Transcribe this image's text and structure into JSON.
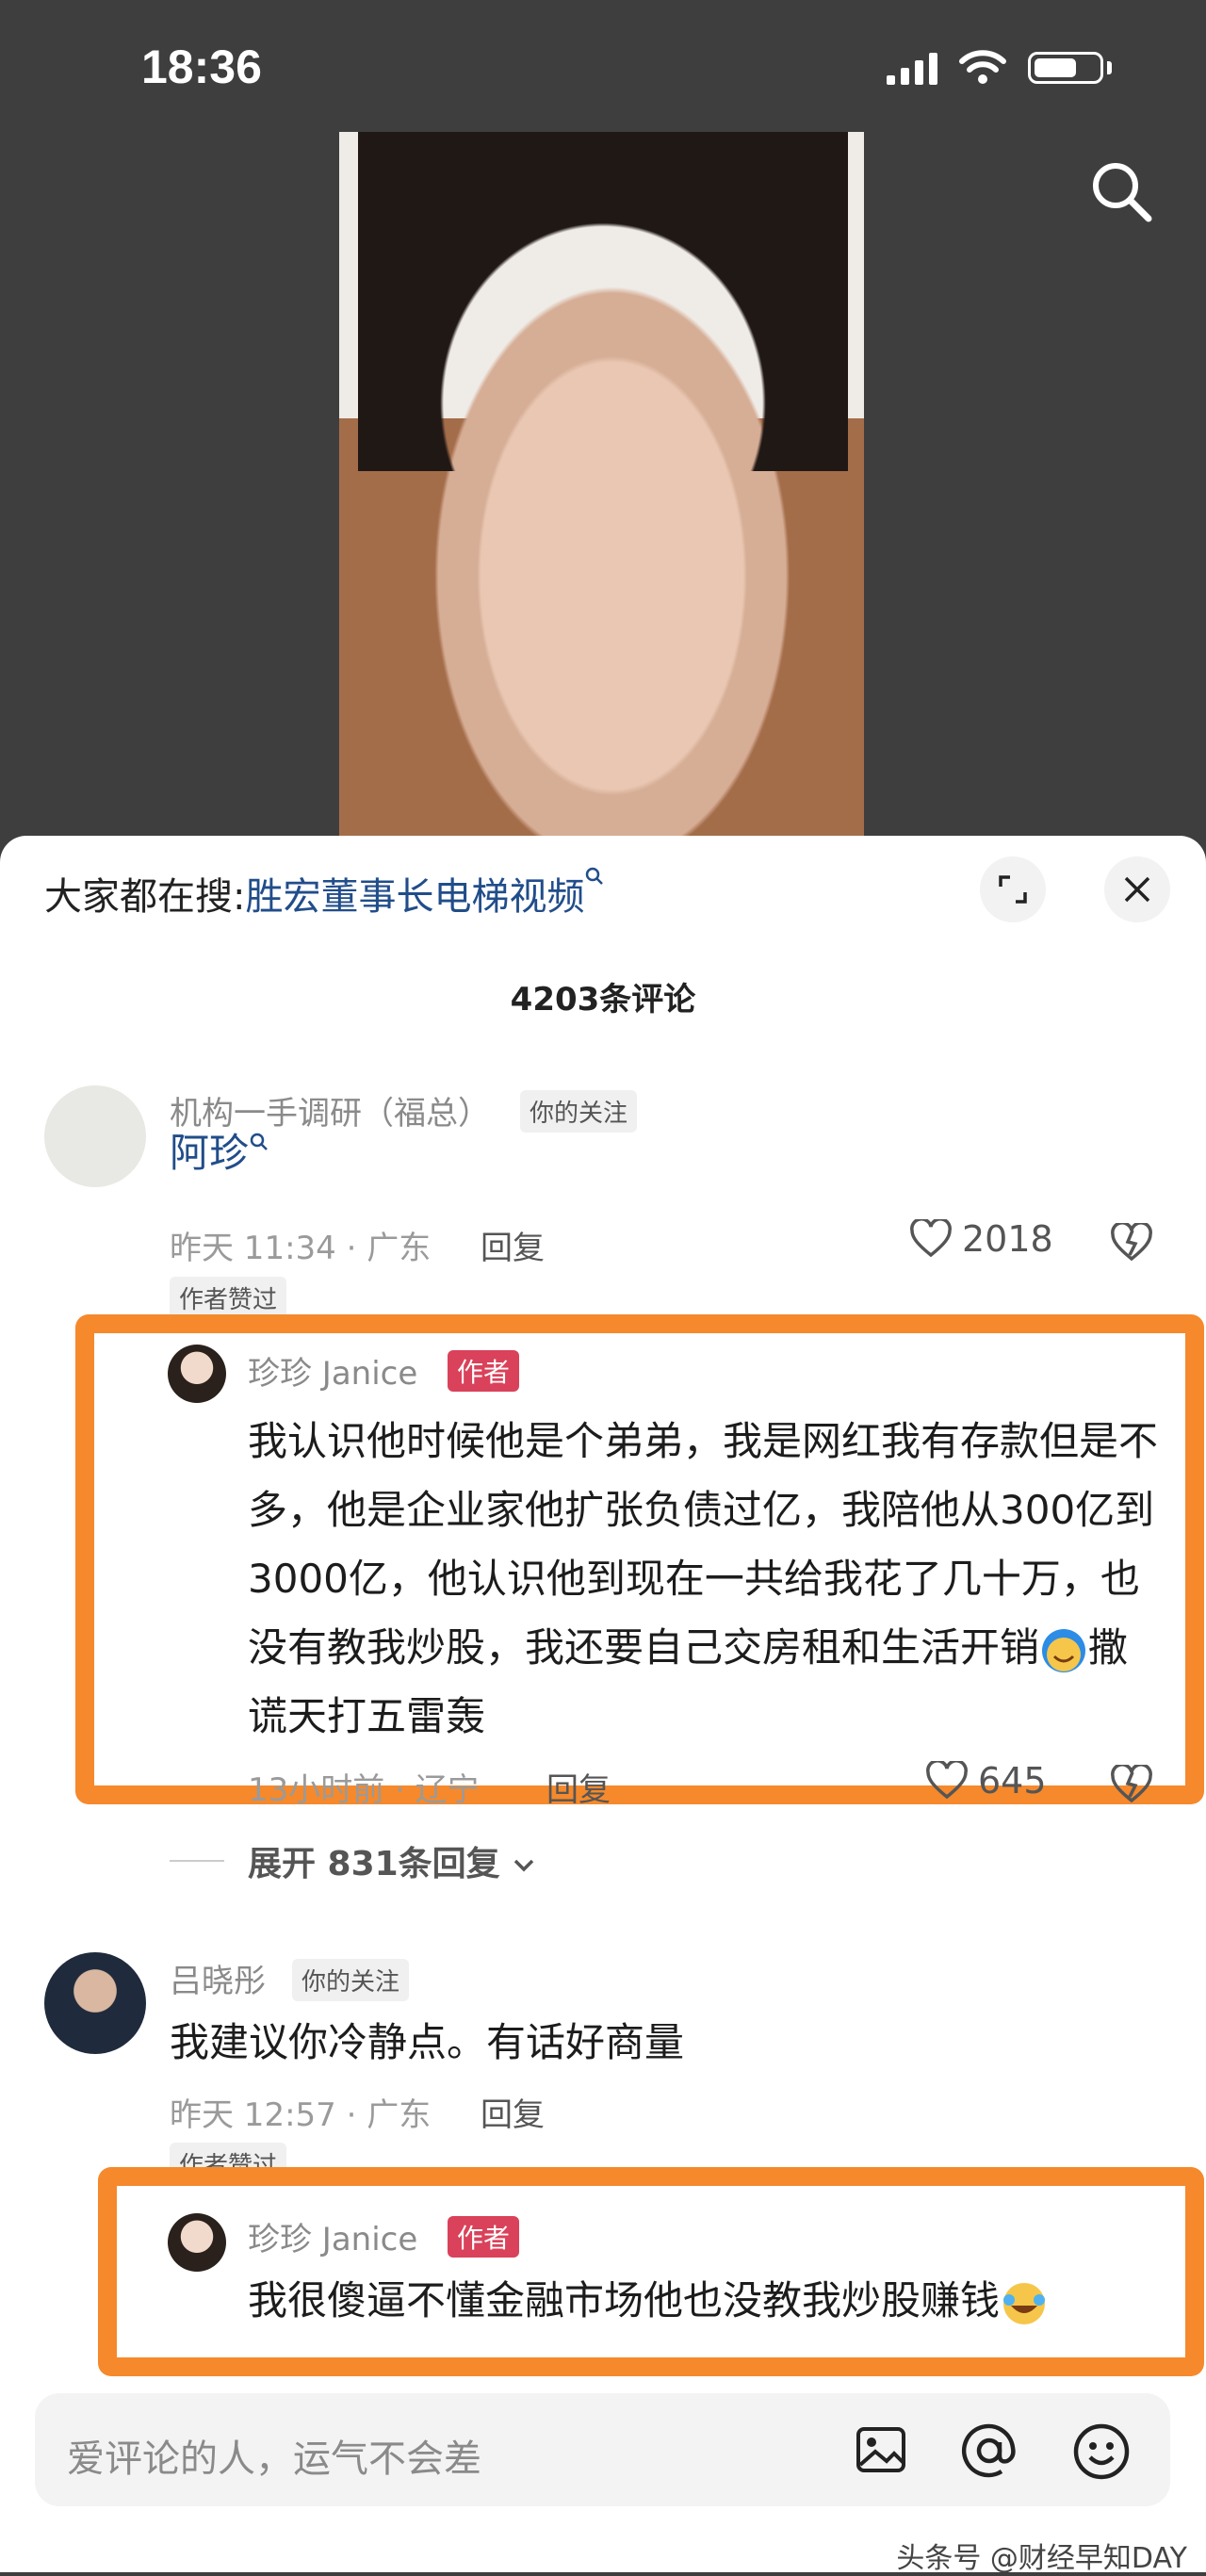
{
  "status": {
    "time": "18:36"
  },
  "sheet": {
    "trending_prefix": "大家都在搜:",
    "trending_query": "胜宏董事长电梯视频",
    "comment_count": "4203条评论"
  },
  "comments": [
    {
      "name": "机构一手调研（福总）",
      "follow_tag": "你的关注",
      "text": "阿珍",
      "meta": "昨天 11:34 · 广东",
      "reply": "回复",
      "likes": "2018",
      "liked_tag": "作者赞过"
    },
    {
      "name": "珍珍 Janice",
      "author_tag": "作者",
      "text": "我认识他时候他是个弟弟，我是网红我有存款但是不多，他是企业家他扩张负债过亿，我陪他从300亿到3000亿，他认识他到现在一共给我花了几十万，也没有教我炒股，我还要自己交房租和生活开销",
      "text_tail": "撒谎天打五雷轰",
      "meta": "13小时前 · 辽宁",
      "reply": "回复",
      "likes": "645",
      "expand": "展开 831条回复"
    },
    {
      "name": "吕晓彤",
      "follow_tag": "你的关注",
      "text": "我建议你冷静点。有话好商量",
      "meta": "昨天 12:57 · 广东",
      "reply": "回复",
      "liked_tag": "作者赞过"
    },
    {
      "name": "珍珍 Janice",
      "author_tag": "作者",
      "text": "我很傻逼不懂金融市场他也没教我炒股赚钱"
    }
  ],
  "input": {
    "placeholder": "爱评论的人，运气不会差"
  },
  "watermark": "头条号 @财经早知DAY",
  "colors": {
    "highlight": "#f5892c",
    "author_tag": "#d9425a",
    "link": "#214d8a"
  },
  "icons": [
    "search-icon",
    "expand-icon",
    "close-icon",
    "heart-icon",
    "dislike-icon",
    "image-icon",
    "at-icon",
    "emoji-icon"
  ]
}
